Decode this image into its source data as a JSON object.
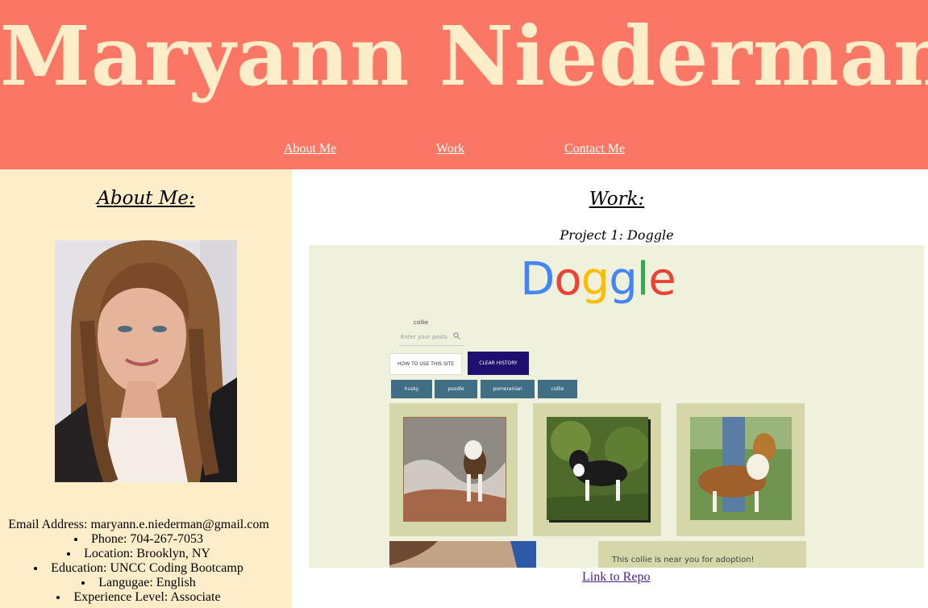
{
  "header": {
    "title": "Maryann Niederman",
    "nav": [
      "About Me",
      "Work",
      "Contact Me"
    ]
  },
  "about": {
    "heading": "About Me:",
    "email": "Email Address: maryann.e.niederman@gmail.com",
    "details": [
      "Phone: 704-267-7053",
      "Location: Brooklyn, NY",
      "Education: UNCC Coding Bootcamp",
      "Langugae: English",
      "Experience Level: Associate"
    ]
  },
  "work": {
    "heading": "Work:",
    "project_title": "Project 1: Doggle",
    "repo_link": "Link to Repo",
    "screenshot": {
      "logo": [
        "D",
        "o",
        "g",
        "g",
        "l",
        "e"
      ],
      "search_value": "collie",
      "search_placeholder": "Enter your posts",
      "how_button": "HOW TO USE THIS SITE",
      "clear_button": "CLEAR HISTORY",
      "tags": [
        "husky",
        "poodle",
        "pomeranian",
        "collie"
      ],
      "adoption_text": "This collie is near you for adoption!"
    }
  },
  "colors": {
    "header_bg": "#fa7665",
    "title_text": "#feedc9",
    "about_bg": "#feedc9",
    "logo": [
      "#4285f4",
      "#ea4335",
      "#fbbc05",
      "#4285f4",
      "#34a853",
      "#ea4335"
    ]
  }
}
